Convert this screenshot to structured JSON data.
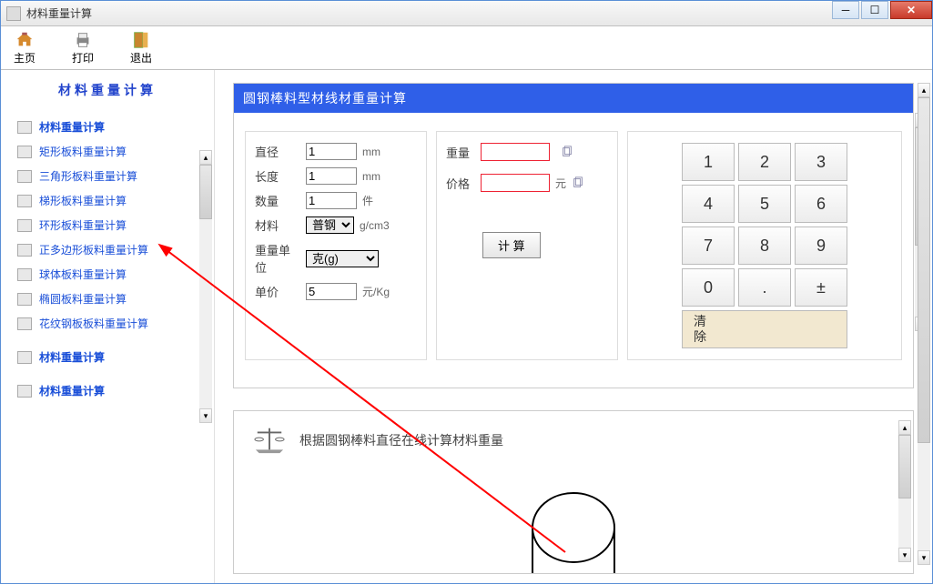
{
  "window": {
    "title": "材料重量计算"
  },
  "toolbar": {
    "home": "主页",
    "print": "打印",
    "exit": "退出"
  },
  "sidebar": {
    "title": "材料重量计算",
    "items": [
      {
        "label": "材料重量计算",
        "bold": true
      },
      {
        "label": "矩形板料重量计算"
      },
      {
        "label": "三角形板料重量计算"
      },
      {
        "label": "梯形板料重量计算"
      },
      {
        "label": "环形板料重量计算"
      },
      {
        "label": "正多边形板料重量计算"
      },
      {
        "label": "球体板料重量计算"
      },
      {
        "label": "椭圆板料重量计算"
      },
      {
        "label": "花纹钢板板料重量计算"
      },
      {
        "gap": true
      },
      {
        "label": "材料重量计算",
        "bold": true
      },
      {
        "gap": true
      },
      {
        "label": "材料重量计算",
        "bold": true
      }
    ]
  },
  "panel": {
    "header": "圆钢棒料型材线材重量计算",
    "fields": {
      "diameter_label": "直径",
      "diameter_value": "1",
      "diameter_unit": "mm",
      "length_label": "长度",
      "length_value": "1",
      "length_unit": "mm",
      "qty_label": "数量",
      "qty_value": "1",
      "qty_unit": "件",
      "material_label": "材料",
      "material_value": "普钢",
      "material_unit": "g/cm3",
      "weightunit_label": "重量单位",
      "weightunit_value": "克(g)",
      "price_label": "单价",
      "price_value": "5",
      "price_unit": "元/Kg"
    },
    "outputs": {
      "weight_label": "重量",
      "price_label": "价格",
      "price_unit": "元"
    },
    "calc_button": "计 算",
    "keypad": [
      "1",
      "2",
      "3",
      "4",
      "5",
      "6",
      "7",
      "8",
      "9",
      "0",
      ".",
      "±"
    ],
    "clear_label": "清\n除"
  },
  "desc": {
    "text": "根据圆钢棒料直径在线计算材料重量"
  }
}
